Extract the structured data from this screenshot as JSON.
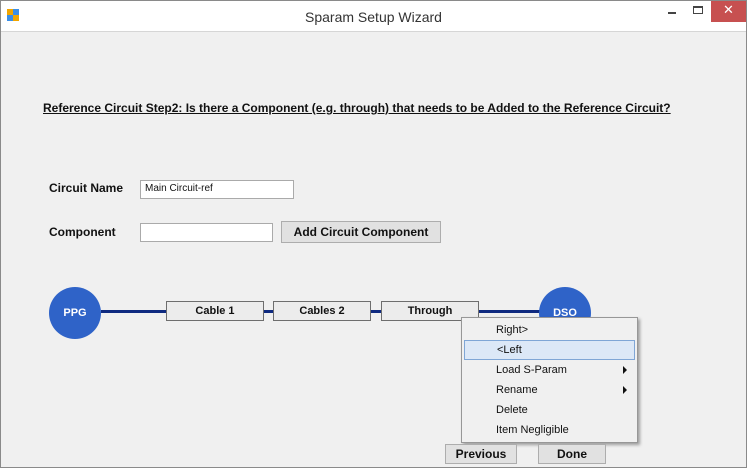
{
  "window": {
    "title": "Sparam Setup Wizard"
  },
  "heading": "Reference Circuit Step2: Is there a Component (e.g. through) that needs to be Added to the Reference Circuit?",
  "form": {
    "circuit_name_label": "Circuit Name",
    "circuit_name_value": "Main Circuit-ref",
    "component_label": "Component",
    "component_value": "",
    "add_button": "Add Circuit Component"
  },
  "circuit": {
    "source_node": "PPG",
    "sink_node": "DSO",
    "components": [
      "Cable 1",
      "Cables 2",
      "Through"
    ],
    "wire_color": "#0f2a80",
    "node_color": "#2f63c8"
  },
  "context_menu": {
    "items": [
      {
        "label": "Right>",
        "submenu": false,
        "highlighted": false
      },
      {
        "label": "<Left",
        "submenu": false,
        "highlighted": true
      },
      {
        "label": "Load S-Param",
        "submenu": true,
        "highlighted": false
      },
      {
        "label": "Rename",
        "submenu": true,
        "highlighted": false
      },
      {
        "label": "Delete",
        "submenu": false,
        "highlighted": false
      },
      {
        "label": "Item Negligible",
        "submenu": false,
        "highlighted": false
      }
    ]
  },
  "footer": {
    "previous": "Previous",
    "done": "Done"
  }
}
